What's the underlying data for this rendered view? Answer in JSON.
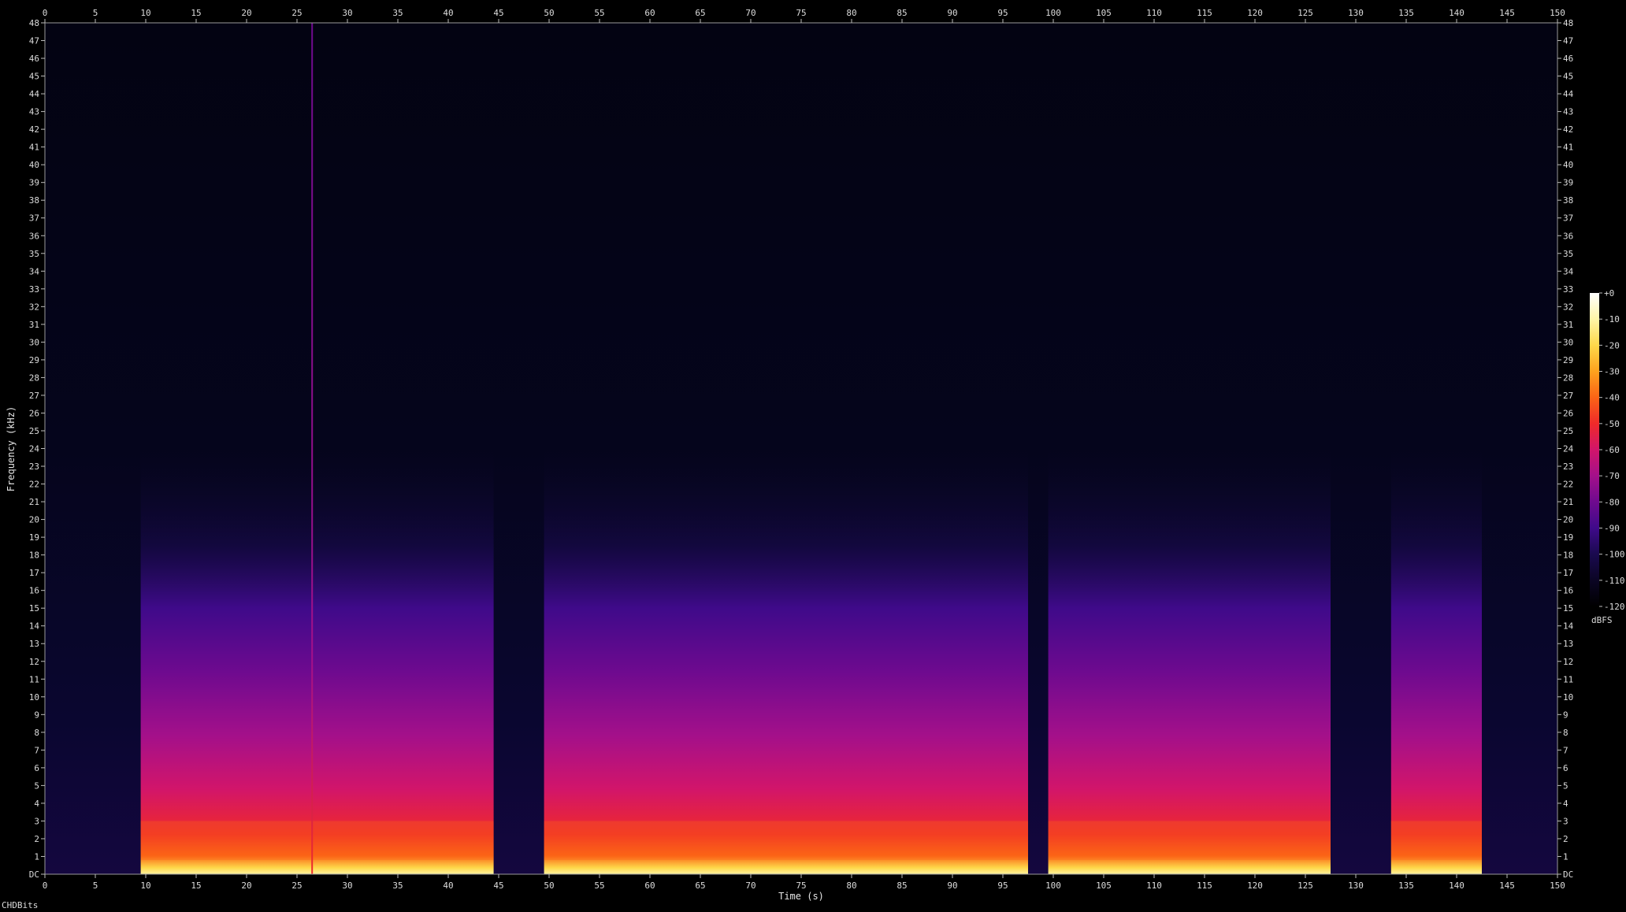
{
  "chart_data": {
    "type": "heatmap",
    "title": "",
    "xlabel": "Time (s)",
    "ylabel": "Frequency (kHz)",
    "xlim": [
      0,
      150
    ],
    "ylim": [
      0,
      48
    ],
    "x_ticks": [
      0,
      5,
      10,
      15,
      20,
      25,
      30,
      35,
      40,
      45,
      50,
      55,
      60,
      65,
      70,
      75,
      80,
      85,
      90,
      95,
      100,
      105,
      110,
      115,
      120,
      125,
      130,
      135,
      140,
      145,
      150
    ],
    "y_ticks": [
      {
        "value": 0,
        "label": "DC"
      },
      {
        "value": 1,
        "label": "1"
      },
      {
        "value": 2,
        "label": "2"
      },
      {
        "value": 3,
        "label": "3"
      },
      {
        "value": 4,
        "label": "4"
      },
      {
        "value": 5,
        "label": "5"
      },
      {
        "value": 6,
        "label": "6"
      },
      {
        "value": 7,
        "label": "7"
      },
      {
        "value": 8,
        "label": "8"
      },
      {
        "value": 9,
        "label": "9"
      },
      {
        "value": 10,
        "label": "10"
      },
      {
        "value": 11,
        "label": "11"
      },
      {
        "value": 12,
        "label": "12"
      },
      {
        "value": 13,
        "label": "13"
      },
      {
        "value": 14,
        "label": "14"
      },
      {
        "value": 15,
        "label": "15"
      },
      {
        "value": 16,
        "label": "16"
      },
      {
        "value": 17,
        "label": "17"
      },
      {
        "value": 18,
        "label": "18"
      },
      {
        "value": 19,
        "label": "19"
      },
      {
        "value": 20,
        "label": "20"
      },
      {
        "value": 21,
        "label": "21"
      },
      {
        "value": 22,
        "label": "22"
      },
      {
        "value": 23,
        "label": "23"
      },
      {
        "value": 24,
        "label": "24"
      },
      {
        "value": 25,
        "label": "25"
      },
      {
        "value": 26,
        "label": "26"
      },
      {
        "value": 27,
        "label": "27"
      },
      {
        "value": 28,
        "label": "28"
      },
      {
        "value": 29,
        "label": "29"
      },
      {
        "value": 30,
        "label": "30"
      },
      {
        "value": 31,
        "label": "31"
      },
      {
        "value": 32,
        "label": "32"
      },
      {
        "value": 33,
        "label": "33"
      },
      {
        "value": 34,
        "label": "34"
      },
      {
        "value": 35,
        "label": "35"
      },
      {
        "value": 36,
        "label": "36"
      },
      {
        "value": 37,
        "label": "37"
      },
      {
        "value": 38,
        "label": "38"
      },
      {
        "value": 39,
        "label": "39"
      },
      {
        "value": 40,
        "label": "40"
      },
      {
        "value": 41,
        "label": "41"
      },
      {
        "value": 42,
        "label": "42"
      },
      {
        "value": 43,
        "label": "43"
      },
      {
        "value": 44,
        "label": "44"
      },
      {
        "value": 45,
        "label": "45"
      },
      {
        "value": 46,
        "label": "46"
      },
      {
        "value": 47,
        "label": "47"
      },
      {
        "value": 48,
        "label": "48"
      }
    ],
    "colorbar": {
      "unit": "dBFS",
      "range_db": [
        -120,
        0
      ],
      "ticks": [
        {
          "value": 0,
          "label": "+0"
        },
        {
          "value": -10,
          "label": "-10"
        },
        {
          "value": -20,
          "label": "-20"
        },
        {
          "value": -30,
          "label": "-30"
        },
        {
          "value": -40,
          "label": "-40"
        },
        {
          "value": -50,
          "label": "-50"
        },
        {
          "value": -60,
          "label": "-60"
        },
        {
          "value": -70,
          "label": "-70"
        },
        {
          "value": -80,
          "label": "-80"
        },
        {
          "value": -90,
          "label": "-90"
        },
        {
          "value": -100,
          "label": "-100"
        },
        {
          "value": -110,
          "label": "-110"
        },
        {
          "value": -120,
          "label": "-120"
        }
      ],
      "colors": [
        "#000000",
        "#0b0524",
        "#1a0a4f",
        "#3f0a8a",
        "#6e0a8f",
        "#a4108a",
        "#d2156a",
        "#ef2a2a",
        "#fb6416",
        "#fea21e",
        "#fed84a",
        "#fff6a8",
        "#ffffff"
      ]
    },
    "active_segments_s": [
      {
        "start": 9.5,
        "end": 44.5
      },
      {
        "start": 49.5,
        "end": 97.5
      },
      {
        "start": 99.5,
        "end": 127.5
      },
      {
        "start": 133.5,
        "end": 142.5
      }
    ],
    "transient_lines_s": [
      26.5
    ],
    "grid": false
  },
  "footer": {
    "credit": "CHDBits"
  }
}
